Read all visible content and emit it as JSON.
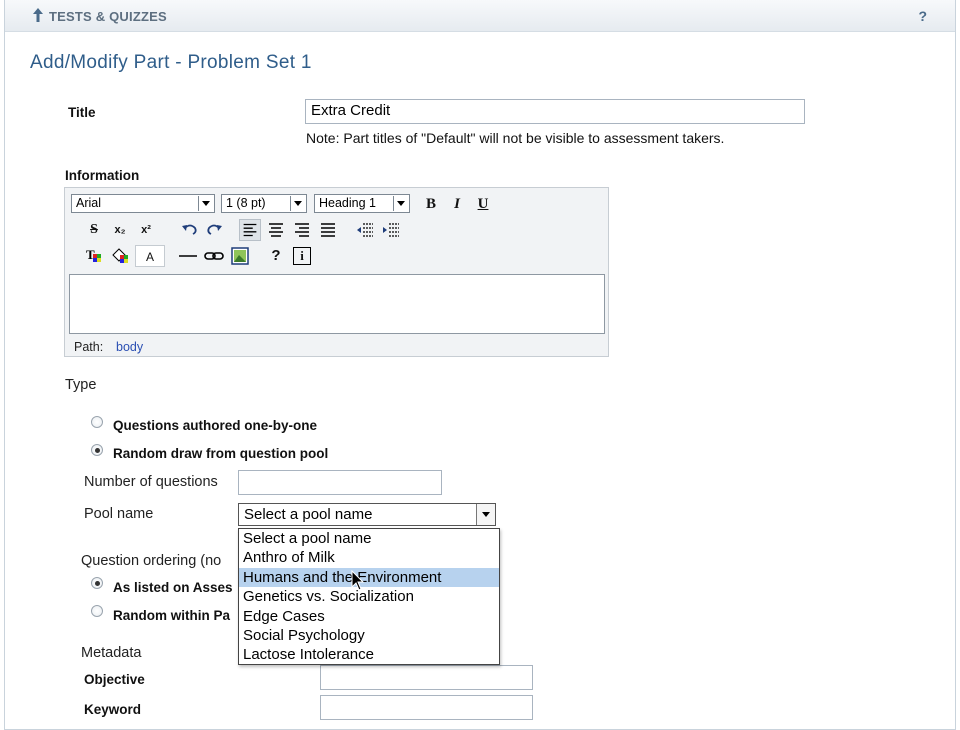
{
  "header": {
    "tool_title": "TESTS & QUIZZES",
    "help": "?"
  },
  "page_title": "Add/Modify Part - Problem Set 1",
  "title_field": {
    "label": "Title",
    "value": "Extra Credit",
    "note": "Note: Part titles of \"Default\" will not be visible to assessment takers."
  },
  "information": {
    "label": "Information",
    "font_family": "Arial",
    "font_size": "1 (8 pt)",
    "format": "Heading 1",
    "path_label": "Path:",
    "path_value": "body",
    "buttons": {
      "bold": "B",
      "italic": "I",
      "underline": "U",
      "strike": "S",
      "sub": "x₂",
      "sup": "x²",
      "text_color": "A",
      "help": "?",
      "info": "i"
    }
  },
  "type": {
    "label": "Type",
    "option_one_by_one": "Questions authored one-by-one",
    "option_random_draw": "Random draw from question pool",
    "selected": "Random draw from question pool"
  },
  "number_of_questions": {
    "label": "Number of questions",
    "value": ""
  },
  "pool": {
    "label": "Pool name",
    "selected": "Select a pool name",
    "options": [
      "Select a pool name",
      "Anthro of Milk",
      "Humans and the Environment",
      "Genetics vs. Socialization",
      "Edge Cases",
      "Social Psychology",
      "Lactose Intolerance"
    ],
    "highlighted": "Humans and the Environment"
  },
  "ordering": {
    "label": "Question ordering (no",
    "option_as_listed": "As listed on Asses",
    "option_random": "Random within Pa",
    "selected": "As listed on Asses"
  },
  "metadata": {
    "label": "Metadata",
    "objective_label": "Objective",
    "objective_value": "",
    "keyword_label": "Keyword",
    "keyword_value": ""
  }
}
